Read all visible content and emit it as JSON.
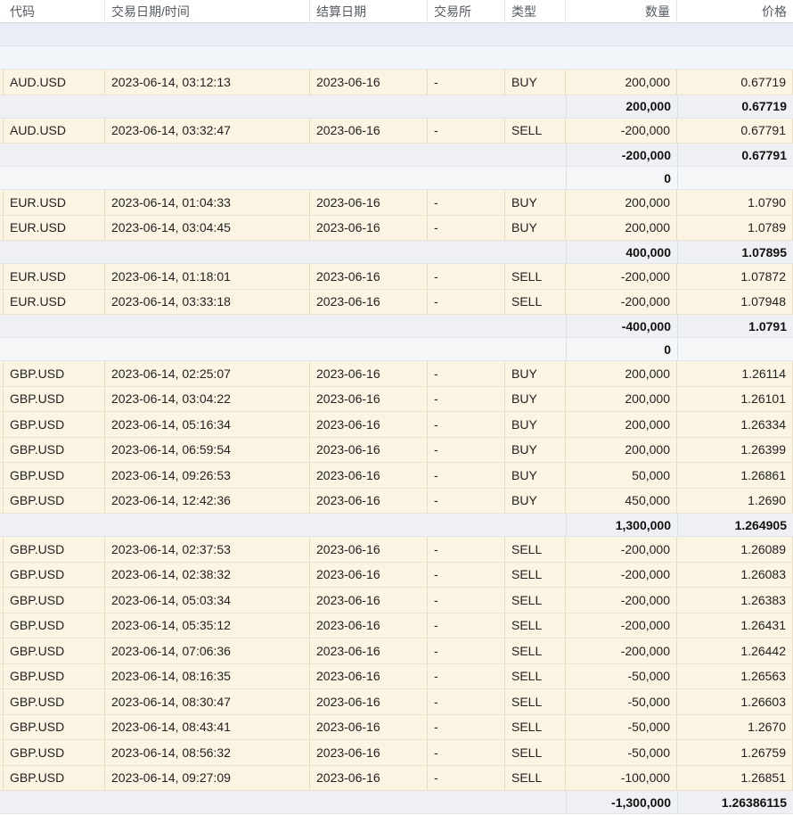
{
  "columns": {
    "code": "代码",
    "datetime": "交易日期/时间",
    "settle": "结算日期",
    "exchange": "交易所",
    "type": "类型",
    "quantity": "数量",
    "price": "价格"
  },
  "rows": [
    {
      "kind": "band-a"
    },
    {
      "kind": "band-b"
    },
    {
      "kind": "detail",
      "code": "AUD.USD",
      "datetime": "2023-06-14, 03:12:13",
      "settle": "2023-06-16",
      "exchange": "-",
      "type": "BUY",
      "quantity": "200,000",
      "price": "0.67719"
    },
    {
      "kind": "sub",
      "quantity": "200,000",
      "price": "0.67719"
    },
    {
      "kind": "detail",
      "code": "AUD.USD",
      "datetime": "2023-06-14, 03:32:47",
      "settle": "2023-06-16",
      "exchange": "-",
      "type": "SELL",
      "quantity": "-200,000",
      "price": "0.67791"
    },
    {
      "kind": "sub",
      "quantity": "-200,000",
      "price": "0.67791"
    },
    {
      "kind": "sub-zero",
      "quantity": "0",
      "price": ""
    },
    {
      "kind": "detail",
      "code": "EUR.USD",
      "datetime": "2023-06-14, 01:04:33",
      "settle": "2023-06-16",
      "exchange": "-",
      "type": "BUY",
      "quantity": "200,000",
      "price": "1.0790"
    },
    {
      "kind": "detail",
      "code": "EUR.USD",
      "datetime": "2023-06-14, 03:04:45",
      "settle": "2023-06-16",
      "exchange": "-",
      "type": "BUY",
      "quantity": "200,000",
      "price": "1.0789"
    },
    {
      "kind": "sub",
      "quantity": "400,000",
      "price": "1.07895"
    },
    {
      "kind": "detail",
      "code": "EUR.USD",
      "datetime": "2023-06-14, 01:18:01",
      "settle": "2023-06-16",
      "exchange": "-",
      "type": "SELL",
      "quantity": "-200,000",
      "price": "1.07872"
    },
    {
      "kind": "detail",
      "code": "EUR.USD",
      "datetime": "2023-06-14, 03:33:18",
      "settle": "2023-06-16",
      "exchange": "-",
      "type": "SELL",
      "quantity": "-200,000",
      "price": "1.07948"
    },
    {
      "kind": "sub",
      "quantity": "-400,000",
      "price": "1.0791"
    },
    {
      "kind": "sub-zero",
      "quantity": "0",
      "price": ""
    },
    {
      "kind": "detail",
      "code": "GBP.USD",
      "datetime": "2023-06-14, 02:25:07",
      "settle": "2023-06-16",
      "exchange": "-",
      "type": "BUY",
      "quantity": "200,000",
      "price": "1.26114"
    },
    {
      "kind": "detail",
      "code": "GBP.USD",
      "datetime": "2023-06-14, 03:04:22",
      "settle": "2023-06-16",
      "exchange": "-",
      "type": "BUY",
      "quantity": "200,000",
      "price": "1.26101"
    },
    {
      "kind": "detail",
      "code": "GBP.USD",
      "datetime": "2023-06-14, 05:16:34",
      "settle": "2023-06-16",
      "exchange": "-",
      "type": "BUY",
      "quantity": "200,000",
      "price": "1.26334"
    },
    {
      "kind": "detail",
      "code": "GBP.USD",
      "datetime": "2023-06-14, 06:59:54",
      "settle": "2023-06-16",
      "exchange": "-",
      "type": "BUY",
      "quantity": "200,000",
      "price": "1.26399"
    },
    {
      "kind": "detail",
      "code": "GBP.USD",
      "datetime": "2023-06-14, 09:26:53",
      "settle": "2023-06-16",
      "exchange": "-",
      "type": "BUY",
      "quantity": "50,000",
      "price": "1.26861"
    },
    {
      "kind": "detail",
      "code": "GBP.USD",
      "datetime": "2023-06-14, 12:42:36",
      "settle": "2023-06-16",
      "exchange": "-",
      "type": "BUY",
      "quantity": "450,000",
      "price": "1.2690"
    },
    {
      "kind": "sub",
      "quantity": "1,300,000",
      "price": "1.264905"
    },
    {
      "kind": "detail",
      "code": "GBP.USD",
      "datetime": "2023-06-14, 02:37:53",
      "settle": "2023-06-16",
      "exchange": "-",
      "type": "SELL",
      "quantity": "-200,000",
      "price": "1.26089"
    },
    {
      "kind": "detail",
      "code": "GBP.USD",
      "datetime": "2023-06-14, 02:38:32",
      "settle": "2023-06-16",
      "exchange": "-",
      "type": "SELL",
      "quantity": "-200,000",
      "price": "1.26083"
    },
    {
      "kind": "detail",
      "code": "GBP.USD",
      "datetime": "2023-06-14, 05:03:34",
      "settle": "2023-06-16",
      "exchange": "-",
      "type": "SELL",
      "quantity": "-200,000",
      "price": "1.26383"
    },
    {
      "kind": "detail",
      "code": "GBP.USD",
      "datetime": "2023-06-14, 05:35:12",
      "settle": "2023-06-16",
      "exchange": "-",
      "type": "SELL",
      "quantity": "-200,000",
      "price": "1.26431"
    },
    {
      "kind": "detail",
      "code": "GBP.USD",
      "datetime": "2023-06-14, 07:06:36",
      "settle": "2023-06-16",
      "exchange": "-",
      "type": "SELL",
      "quantity": "-200,000",
      "price": "1.26442"
    },
    {
      "kind": "detail",
      "code": "GBP.USD",
      "datetime": "2023-06-14, 08:16:35",
      "settle": "2023-06-16",
      "exchange": "-",
      "type": "SELL",
      "quantity": "-50,000",
      "price": "1.26563"
    },
    {
      "kind": "detail",
      "code": "GBP.USD",
      "datetime": "2023-06-14, 08:30:47",
      "settle": "2023-06-16",
      "exchange": "-",
      "type": "SELL",
      "quantity": "-50,000",
      "price": "1.26603"
    },
    {
      "kind": "detail",
      "code": "GBP.USD",
      "datetime": "2023-06-14, 08:43:41",
      "settle": "2023-06-16",
      "exchange": "-",
      "type": "SELL",
      "quantity": "-50,000",
      "price": "1.2670"
    },
    {
      "kind": "detail",
      "code": "GBP.USD",
      "datetime": "2023-06-14, 08:56:32",
      "settle": "2023-06-16",
      "exchange": "-",
      "type": "SELL",
      "quantity": "-50,000",
      "price": "1.26759"
    },
    {
      "kind": "detail",
      "code": "GBP.USD",
      "datetime": "2023-06-14, 09:27:09",
      "settle": "2023-06-16",
      "exchange": "-",
      "type": "SELL",
      "quantity": "-100,000",
      "price": "1.26851"
    },
    {
      "kind": "sub",
      "quantity": "-1,300,000",
      "price": "1.26386115"
    }
  ]
}
